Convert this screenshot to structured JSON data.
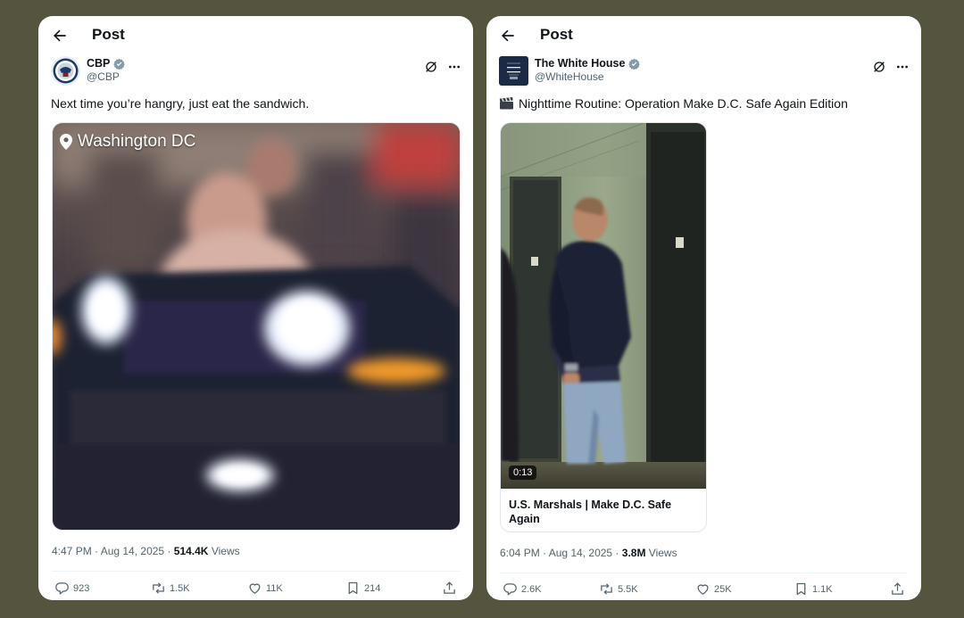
{
  "colors": {
    "page_background": "#55553f",
    "card_background": "#ffffff",
    "verified_badge": "#829aab",
    "secondary_text": "#536471"
  },
  "posts": [
    {
      "header_title": "Post",
      "author": {
        "display_name": "CBP",
        "handle": "@CBP",
        "verified": true,
        "avatar_icon": "cbp-seal-icon"
      },
      "text": "Next time you’re hangry, just eat the sandwich.",
      "media": {
        "type": "video",
        "location_label": "Washington DC",
        "description_icon": "blurred-car-at-night"
      },
      "timestamp": "4:47 PM · Aug 14, 2025 · ",
      "views_count": "514.4K",
      "views_label": "Views",
      "actions": {
        "replies": "923",
        "reposts": "1.5K",
        "likes": "11K",
        "bookmarks": "214"
      }
    },
    {
      "header_title": "Post",
      "author": {
        "display_name": "The White House",
        "handle": "@WhiteHouse",
        "verified": true,
        "avatar_icon": "white-house-logo-icon"
      },
      "text_emoji_icon": "film-clapper-icon",
      "text": "Nighttime Routine: Operation Make D.C. Safe Again Edition",
      "media": {
        "type": "video-card",
        "duration": "0:13",
        "card_title": "U.S. Marshals | Make D.C. Safe Again"
      },
      "timestamp": "6:04 PM · Aug 14, 2025 · ",
      "views_count": "3.8M",
      "views_label": "Views",
      "actions": {
        "replies": "2.6K",
        "reposts": "5.5K",
        "likes": "25K",
        "bookmarks": "1.1K"
      }
    }
  ]
}
